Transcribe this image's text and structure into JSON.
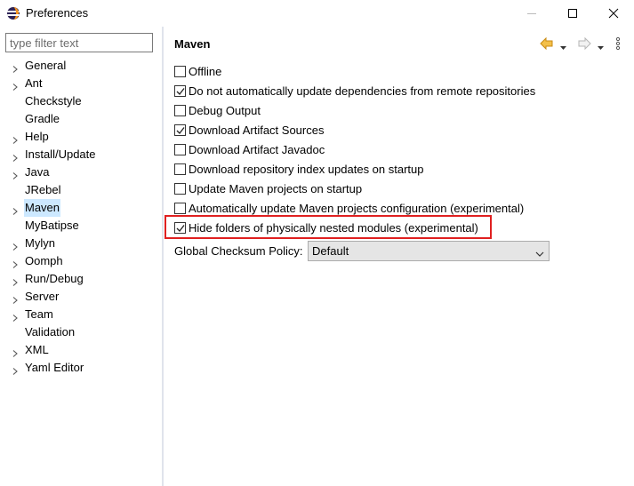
{
  "window": {
    "title": "Preferences",
    "controls": [
      "minimize",
      "maximize",
      "close"
    ]
  },
  "filter": {
    "placeholder": "type filter text",
    "value": ""
  },
  "tree": {
    "items": [
      {
        "label": "General",
        "expandable": true,
        "selected": false
      },
      {
        "label": "Ant",
        "expandable": true,
        "selected": false
      },
      {
        "label": "Checkstyle",
        "expandable": false,
        "selected": false
      },
      {
        "label": "Gradle",
        "expandable": false,
        "selected": false
      },
      {
        "label": "Help",
        "expandable": true,
        "selected": false
      },
      {
        "label": "Install/Update",
        "expandable": true,
        "selected": false
      },
      {
        "label": "Java",
        "expandable": true,
        "selected": false
      },
      {
        "label": "JRebel",
        "expandable": false,
        "selected": false
      },
      {
        "label": "Maven",
        "expandable": true,
        "selected": true
      },
      {
        "label": "MyBatipse",
        "expandable": false,
        "selected": false
      },
      {
        "label": "Mylyn",
        "expandable": true,
        "selected": false
      },
      {
        "label": "Oomph",
        "expandable": true,
        "selected": false
      },
      {
        "label": "Run/Debug",
        "expandable": true,
        "selected": false
      },
      {
        "label": "Server",
        "expandable": true,
        "selected": false
      },
      {
        "label": "Team",
        "expandable": true,
        "selected": false
      },
      {
        "label": "Validation",
        "expandable": false,
        "selected": false
      },
      {
        "label": "XML",
        "expandable": true,
        "selected": false
      },
      {
        "label": "Yaml Editor",
        "expandable": true,
        "selected": false
      }
    ]
  },
  "page": {
    "title": "Maven",
    "nav_icons": [
      "back-arrow-icon",
      "back-menu-icon",
      "forward-arrow-icon",
      "forward-menu-icon",
      "view-menu-icon"
    ]
  },
  "options": [
    {
      "label": "Offline",
      "checked": false
    },
    {
      "label": "Do not automatically update dependencies from remote repositories",
      "checked": true
    },
    {
      "label": "Debug Output",
      "checked": false
    },
    {
      "label": "Download Artifact Sources",
      "checked": true
    },
    {
      "label": "Download Artifact Javadoc",
      "checked": false
    },
    {
      "label": "Download repository index updates on startup",
      "checked": false
    },
    {
      "label": "Update Maven projects on startup",
      "checked": false
    },
    {
      "label": "Automatically update Maven projects configuration (experimental)",
      "checked": false
    },
    {
      "label": "Hide folders of physically nested modules (experimental)",
      "checked": true
    }
  ],
  "checksum": {
    "label": "Global Checksum Policy:",
    "value": "Default"
  },
  "colors": {
    "selection": "#cce8ff",
    "highlight_border": "#e02020",
    "divider": "#e0e4ec",
    "nav_arrow": "#e8a317"
  }
}
